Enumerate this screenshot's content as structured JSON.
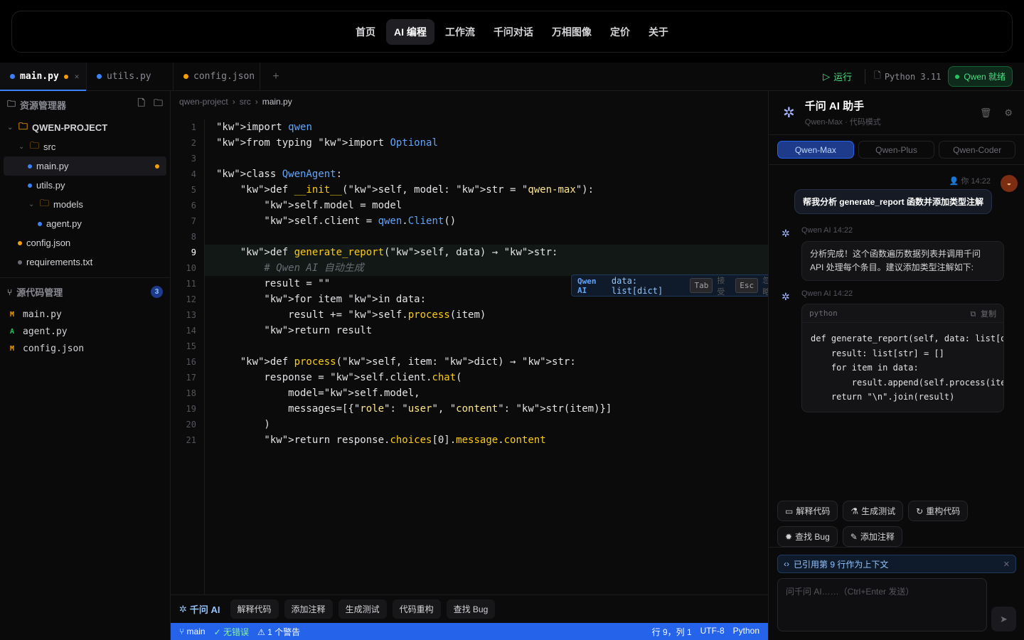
{
  "nav": {
    "items": [
      "首页",
      "AI 编程",
      "工作流",
      "千问对话",
      "万相图像",
      "定价",
      "关于"
    ],
    "active": "AI 编程"
  },
  "tabs": [
    {
      "name": "main.py",
      "dot_color": "#3b82f6",
      "modified": true,
      "active": true
    },
    {
      "name": "utils.py",
      "dot_color": "#3b82f6",
      "modified": false,
      "active": false
    },
    {
      "name": "config.json",
      "dot_color": "#f59e0b",
      "modified": false,
      "active": false
    }
  ],
  "toolbar": {
    "run_label": "运行",
    "python_version": "Python 3.11",
    "qwen_status": "Qwen 就绪"
  },
  "explorer": {
    "title": "资源管理器",
    "project": "QWEN-PROJECT",
    "folder_src": "src",
    "file_main": "main.py",
    "file_utils": "utils.py",
    "folder_models": "models",
    "file_agent": "agent.py",
    "file_config": "config.json",
    "file_requirements": "requirements.txt"
  },
  "scm": {
    "title": "源代码管理",
    "count": "3",
    "items": [
      {
        "letter": "M",
        "name": "main.py",
        "color": "#f59e0b"
      },
      {
        "letter": "A",
        "name": "agent.py",
        "color": "#22c55e"
      },
      {
        "letter": "M",
        "name": "config.json",
        "color": "#f59e0b"
      }
    ]
  },
  "breadcrumb": [
    "qwen-project",
    "src",
    "main.py"
  ],
  "code": {
    "current_line": 9,
    "lines": [
      "\"kw\">import qwen",
      "\"kw\">from typing \"kw\">import Optional",
      "",
      "\"kw\">class QwenAgent:",
      "    \"kw\">def __init__(\"kw\">self, model: \"kw\">str = \"qwen-max\"):",
      "        \"kw\">self.model = model",
      "        \"kw\">self.client = qwen.Client()",
      "",
      "    \"kw\">def generate_report(\"kw\">self, data) → \"kw\">str:",
      "        # Qwen AI 自动生成",
      "        result = \"\"",
      "        \"kw\">for item \"kw\">in data:",
      "            result += \"kw\">self.process(item)",
      "        \"kw\">return result",
      "",
      "    \"kw\">def process(\"kw\">self, item: \"kw\">dict) → \"kw\">str:",
      "        response = \"kw\">self.client.chat(",
      "            model=\"kw\">self.model,",
      "            messages=[{\"role\": \"user\", \"content\": \"kw\">str(item)}]",
      "        )",
      "        \"kw\">return response.choices[0].message.content"
    ]
  },
  "ghost": {
    "brand": "Qwen AI",
    "text": "data: list[dict]",
    "tab_key": "Tab",
    "accept": "接受",
    "esc_key": "Esc",
    "dismiss": "忽略"
  },
  "ai_toolbar": {
    "brand": "千问 AI",
    "actions": [
      "解释代码",
      "添加注释",
      "生成测试",
      "代码重构",
      "查找 Bug"
    ]
  },
  "status": {
    "branch": "main",
    "errors": "无错误",
    "warnings": "1 个警告",
    "position": "行 9，列 1",
    "encoding": "UTF-8",
    "language": "Python"
  },
  "chat": {
    "title": "千问 AI 助手",
    "subtitle": "Qwen-Max · 代码模式",
    "models": [
      "Qwen-Max",
      "Qwen-Plus",
      "Qwen-Coder"
    ],
    "active_model": "Qwen-Max",
    "user_label": "你",
    "user_time": "14:22",
    "user_message": "帮我分析 generate_report 函数并添加类型注解",
    "ai_name": "Qwen AI",
    "ai_time_1": "14:22",
    "ai_message_1": "分析完成！这个函数遍历数据列表并调用千问 API 处理每个条目。建议添加类型注解如下:",
    "ai_time_2": "14:22",
    "code_lang": "python",
    "copy_label": "复制",
    "code_lines": [
      "def generate_report(self, data: list[dict]) -> str:",
      "    result: list[str] = []",
      "    for item in data:",
      "        result.append(self.process(item))",
      "    return \"\\n\".join(result)"
    ],
    "quick_actions": [
      "解释代码",
      "生成测试",
      "重构代码",
      "查找 Bug",
      "添加注释"
    ],
    "context_label": "已引用第 9 行作为上下文",
    "input_placeholder": "问千问 AI……（Ctrl+Enter 发送）"
  }
}
